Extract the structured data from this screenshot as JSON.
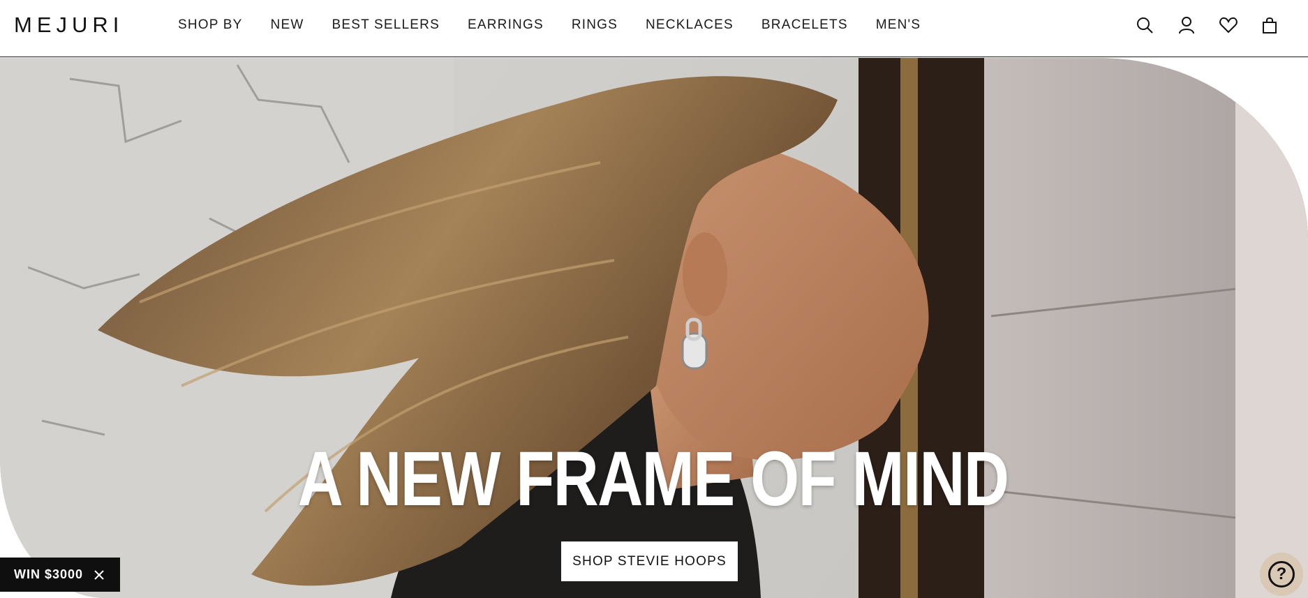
{
  "brand": {
    "logo": "MEJURI"
  },
  "nav": {
    "items": [
      {
        "label": "SHOP BY"
      },
      {
        "label": "NEW"
      },
      {
        "label": "BEST SELLERS"
      },
      {
        "label": "EARRINGS"
      },
      {
        "label": "RINGS"
      },
      {
        "label": "NECKLACES"
      },
      {
        "label": "BRACELETS"
      },
      {
        "label": "MEN'S"
      }
    ]
  },
  "header_icons": [
    "search-icon",
    "account-icon",
    "wishlist-heart-icon",
    "shopping-bag-icon"
  ],
  "hero": {
    "headline": "A NEW FRAME OF MIND",
    "cta_label": "SHOP STEVIE HOOPS"
  },
  "promo": {
    "label": "WIN $3000",
    "close_icon": "close-icon"
  },
  "help": {
    "label": "?",
    "icon": "help-icon"
  },
  "colors": {
    "header_bg": "#ffffff",
    "text": "#111111",
    "promo_bg": "#0f0f0f",
    "help_bg": "#d9c9b4"
  }
}
